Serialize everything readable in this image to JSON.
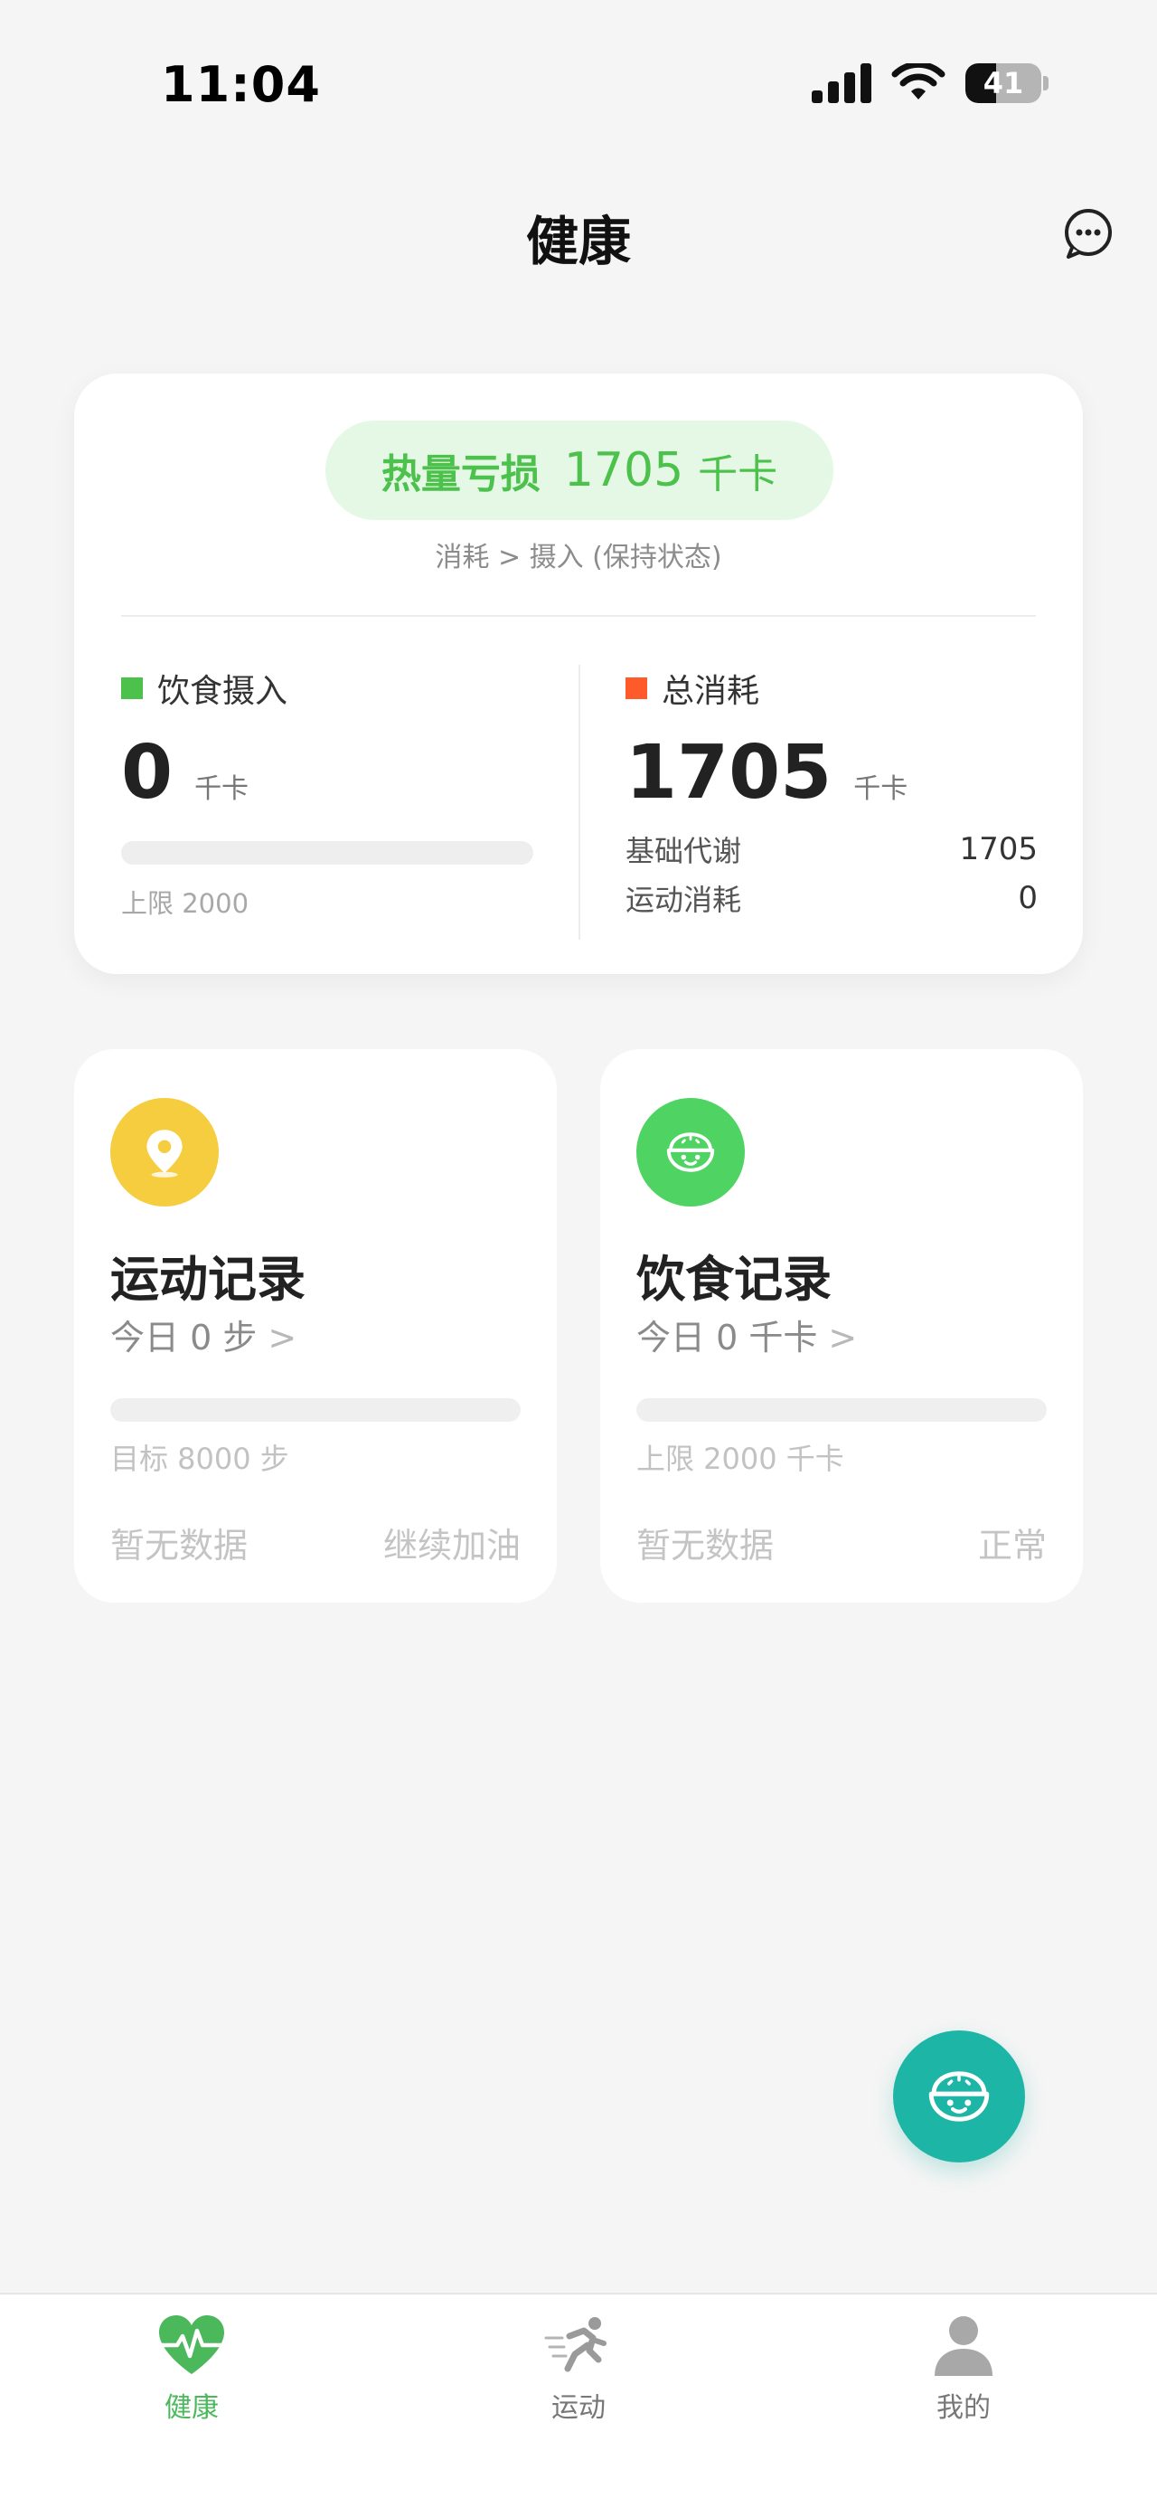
{
  "status_bar": {
    "time": "11:04",
    "battery": "41",
    "battery_level": 0.41
  },
  "header": {
    "title": "健康",
    "chat_icon": "chat-bubble-icon"
  },
  "summary": {
    "deficit_label": "热量亏损",
    "deficit_value": "1705",
    "deficit_unit": "千卡",
    "deficit_sub": "消耗 > 摄入 (保持状态)",
    "intake": {
      "label": "饮食摄入",
      "value": "0",
      "unit": "千卡",
      "limit_text": "上限 2000",
      "progress": 0,
      "color": "#4cc14c"
    },
    "burn": {
      "label": "总消耗",
      "value": "1705",
      "unit": "千卡",
      "color": "#ff5a2a",
      "rows": [
        {
          "label": "基础代谢",
          "value": "1705"
        },
        {
          "label": "运动消耗",
          "value": "0"
        }
      ]
    }
  },
  "records": {
    "exercise": {
      "icon": "location-pin-icon",
      "icon_color": "#f5cd3f",
      "title": "运动记录",
      "today": "今日 0 步",
      "chevron": ">",
      "progress": 0,
      "target": "目标 8000 步",
      "status_left": "暂无数据",
      "status_right": "继续加油"
    },
    "diet": {
      "icon": "rice-bowl-icon",
      "icon_color": "#4fd464",
      "title": "饮食记录",
      "today": "今日 0 千卡",
      "chevron": ">",
      "progress": 0,
      "target": "上限 2000 千卡",
      "status_left": "暂无数据",
      "status_right": "正常"
    }
  },
  "fab": {
    "icon": "rice-bowl-icon",
    "color": "#1db5a5"
  },
  "tabbar": {
    "items": [
      {
        "label": "健康",
        "icon": "heart-pulse-icon",
        "active": true
      },
      {
        "label": "运动",
        "icon": "runner-icon",
        "active": false
      },
      {
        "label": "我的",
        "icon": "person-icon",
        "active": false
      }
    ],
    "active_color": "#4cb85c"
  }
}
